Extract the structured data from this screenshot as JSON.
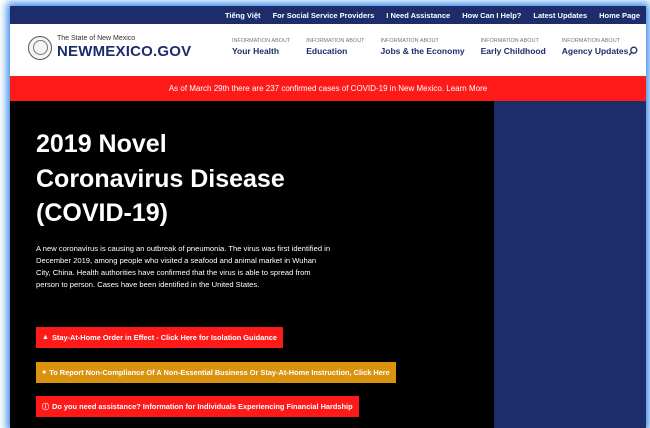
{
  "utility_nav": [
    "Tiếng Việt",
    "For Social Service Providers",
    "I Need Assistance",
    "How Can I Help?",
    "Latest Updates",
    "Home Page"
  ],
  "logo": {
    "small": "The State of New Mexico",
    "big": "NEWMEXICO.GOV"
  },
  "main_nav": [
    {
      "small": "Information About",
      "big": "Your Health"
    },
    {
      "small": "Information About",
      "big": "Education"
    },
    {
      "small": "Information About",
      "big": "Jobs & the Economy"
    },
    {
      "small": "Information About",
      "big": "Early Childhood"
    },
    {
      "small": "Information About",
      "big": "Agency Updates"
    }
  ],
  "alert": "As of March 29th there are 237 confirmed cases of COVID-19 in New Mexico. Learn More",
  "hero": {
    "title_line1": "2019 Novel",
    "title_line2": "Coronavirus Disease",
    "title_line3": "(COVID-19)",
    "body": "A new coronavirus is causing an outbreak of pneumonia. The virus was first identified in December 2019, among people who visited a seafood and animal market in Wuhan City, China. Health authorities have confirmed that the virus is able to spread from person to person. Cases have been identified in the United States."
  },
  "buttons": {
    "stay_home": "Stay-At-Home Order in Effect - Click Here for Isolation Guidance",
    "report": "To Report Non-Compliance Of A Non-Essential Business Or Stay-At-Home Instruction, Click Here",
    "assistance": "Do you need assistance? Information for Individuals Experiencing Financial Hardship"
  },
  "icons": {
    "search": "search-icon",
    "warning": "warning-icon",
    "chat": "chat-bubble-icon",
    "info": "info-icon"
  },
  "colors": {
    "navy": "#1d2d6b",
    "alert_red": "#ff1a1a",
    "orange": "#d9930f",
    "hero_bg": "#000000"
  }
}
